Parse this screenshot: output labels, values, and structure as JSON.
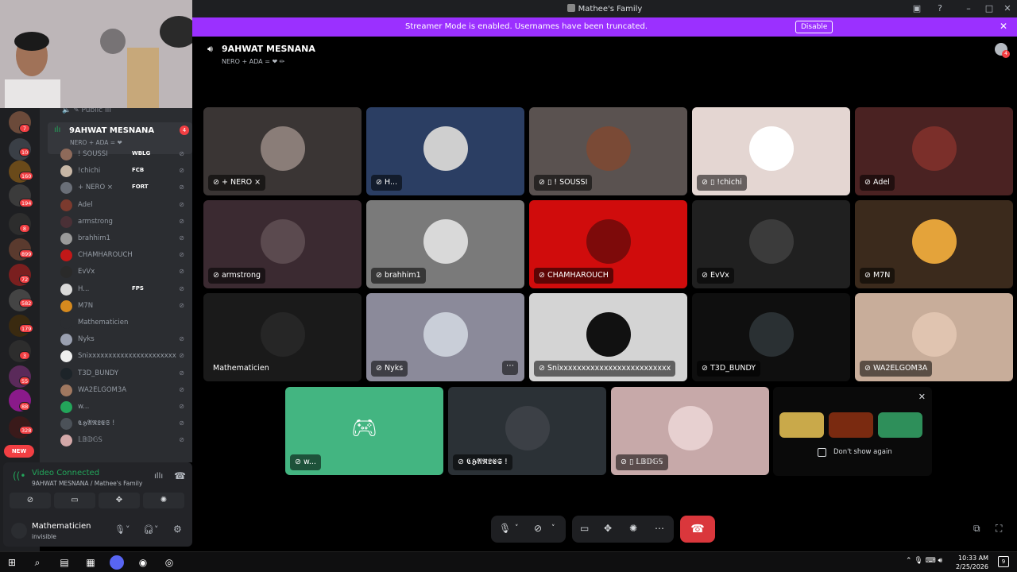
{
  "window": {
    "title": "Mathee's Family"
  },
  "banner": {
    "message": "Streamer Mode is enabled. Usernames have been truncated.",
    "button": "Disable"
  },
  "rail": {
    "badges": [
      "7",
      "10",
      "160",
      "194",
      "8",
      "899",
      "72",
      "582",
      "179",
      "3",
      "55",
      "88",
      "328"
    ],
    "new_label": "NEW"
  },
  "sidebar": {
    "prev_channel": "Public III",
    "channel": {
      "name": "9AHWAT MESNANA",
      "sub": "NERO + ADA = ❤",
      "badge": "4"
    },
    "members": [
      {
        "name": "! SOUSSI",
        "tag": "WBLG",
        "color": "#8e6a5a"
      },
      {
        "name": "!chichi",
        "tag": "FCB",
        "color": "#c8b7a6"
      },
      {
        "name": "+ NERO ×",
        "tag": "FORT",
        "color": "#6a6f78"
      },
      {
        "name": "Adel",
        "tag": "",
        "color": "#7b3a2e"
      },
      {
        "name": "armstrong",
        "tag": "",
        "color": "#4a3036"
      },
      {
        "name": "brahhim1",
        "tag": "",
        "color": "#9a9a9a"
      },
      {
        "name": "CHAMHAROUCH",
        "tag": "",
        "color": "#c21818"
      },
      {
        "name": "EvVx",
        "tag": "",
        "color": "#2a2a2a"
      },
      {
        "name": "H...",
        "tag": "FPS",
        "color": "#d9d9d9"
      },
      {
        "name": "M7N",
        "tag": "",
        "color": "#d68a1e"
      },
      {
        "name": "Mathematicien",
        "tag": "",
        "color": "#2b2d31"
      },
      {
        "name": "Nyks",
        "tag": "",
        "color": "#9aa0b0"
      },
      {
        "name": "Snixxxxxxxxxxxxxxxxxxxxxxxxx",
        "tag": "",
        "color": "#eeeeee"
      },
      {
        "name": "T3D_BUNDY",
        "tag": "",
        "color": "#1d2429"
      },
      {
        "name": "WA2ELGOM3A",
        "tag": "",
        "color": "#a07860"
      },
      {
        "name": "w...",
        "tag": "",
        "color": "#23a55a"
      },
      {
        "name": "𝕮𝕳𝕬𝕽𝕷𝕰𝕾 !",
        "tag": "",
        "color": "#4b5158"
      },
      {
        "name": "𝕃𝔹𝔻𝔾𝕊",
        "tag": "",
        "color": "#d3a8a8"
      }
    ]
  },
  "voice_panel": {
    "status": "Video Connected",
    "location": "9AHWAT MESNANA / Mathee's Family",
    "user": "Mathematicien",
    "user_status": "invisible"
  },
  "call": {
    "title": "9AHWAT MESNANA",
    "subtitle": "NERO + ADA = ❤ ✏",
    "notif_count": "4",
    "tiles": [
      {
        "label": "+ NERO ×",
        "bg": "#3a3534",
        "avatar": "#8a7d78",
        "icon": "mute"
      },
      {
        "label": "H...",
        "bg": "#2b3e63",
        "avatar": "#cfcfcf",
        "icon": "mute"
      },
      {
        "label": "! SOUSSI",
        "bg": "#5a5250",
        "avatar": "#7a4a36",
        "icon": "mute-phone"
      },
      {
        "label": "!chichi",
        "bg": "#e4d6d2",
        "avatar": "#ffffff",
        "icon": "mute-phone"
      },
      {
        "label": "Adel",
        "bg": "#4a2222",
        "avatar": "#7b2f2a",
        "icon": "mute"
      },
      {
        "label": "armstrong",
        "bg": "#3b2a31",
        "avatar": "#5b4a4f",
        "icon": "mute"
      },
      {
        "label": "brahhim1",
        "bg": "#7a7a7a",
        "avatar": "#d9d9d9",
        "icon": "deaf"
      },
      {
        "label": "CHAMHAROUCH",
        "bg": "#d00c0c",
        "avatar": "#7d0a0a",
        "icon": "mute"
      },
      {
        "label": "EvVx",
        "bg": "#202020",
        "avatar": "#3b3b3b",
        "icon": "mute"
      },
      {
        "label": "M7N",
        "bg": "#3b2a1c",
        "avatar": "#e4a33a",
        "icon": "mute"
      },
      {
        "label": "Mathematicien",
        "bg": "#1a1a1a",
        "avatar": "#262626",
        "icon": "none"
      },
      {
        "label": "Nyks",
        "bg": "#8b8a9a",
        "avatar": "#c9ced8",
        "icon": "mute"
      },
      {
        "label": "Snixxxxxxxxxxxxxxxxxxxxxxxxx",
        "bg": "#d4d4d4",
        "avatar": "#111111",
        "icon": "mute"
      },
      {
        "label": "T3D_BUNDY",
        "bg": "#0f0f0f",
        "avatar": "#2a3033",
        "icon": "mute"
      },
      {
        "label": "WA2ELGOM3A",
        "bg": "#c8ad9a",
        "avatar": "#e0c4b0",
        "icon": "mute"
      },
      {
        "label": "w...",
        "bg": "#43b581",
        "avatar": "#43b581",
        "icon": "mute"
      },
      {
        "label": "𝕮𝕳𝕬𝕽𝕷𝕰𝕾 !",
        "bg": "#2b3136",
        "avatar": "#3c4046",
        "icon": "mute"
      },
      {
        "label": "𝕃𝔹𝔻𝔾𝕊",
        "bg": "#c7a9a9",
        "avatar": "#e7d0d0",
        "icon": "mute-phone"
      }
    ],
    "promo": {
      "dont_show": "Don't show again",
      "game_colors": [
        "#c9a94a",
        "#7a2a10",
        "#2e8f5a"
      ]
    }
  },
  "taskbar": {
    "time": "10:33 AM",
    "date": "2/25/2026",
    "notif_count": "9"
  },
  "colors": {
    "accent": "#5865f2",
    "banner": "#9b30ff",
    "end_call": "#da373c",
    "connected": "#23a55a"
  }
}
